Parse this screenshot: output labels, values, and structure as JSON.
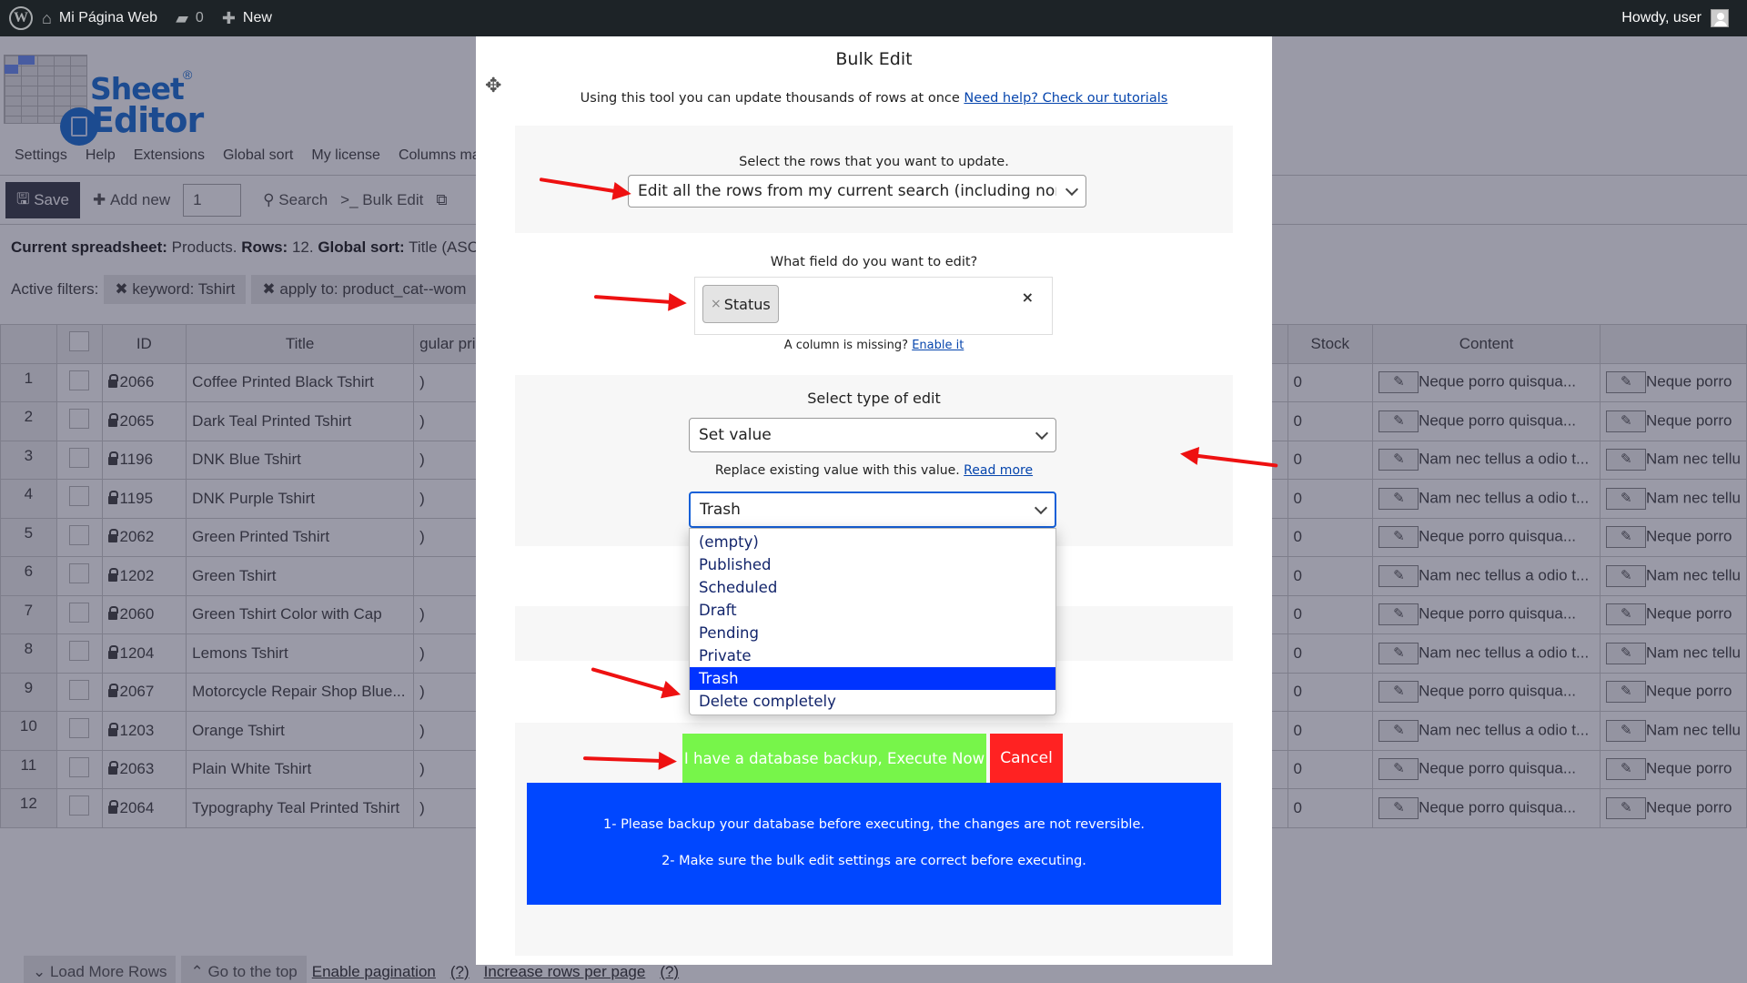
{
  "adminbar": {
    "site_name": "Mi Página Web",
    "comments_count": "0",
    "new_label": "New",
    "greeting": "Howdy, user"
  },
  "logo": {
    "line1": "Sheet",
    "line2": "Editor",
    "reg": "®"
  },
  "menu": [
    "Settings",
    "Help",
    "Extensions",
    "Global sort",
    "My license",
    "Columns ma"
  ],
  "toolbar": {
    "save": "Save",
    "add_new": "Add new",
    "add_qty": "1",
    "search": "Search",
    "bulk_edit": "Bulk Edit"
  },
  "meta": {
    "spreadsheet_label": "Current spreadsheet:",
    "spreadsheet_value": "Products.",
    "rows_label": "Rows:",
    "rows_value": "12.",
    "sort_label": "Global sort:",
    "sort_value": "Title (ASC)."
  },
  "filters": {
    "label": "Active filters:",
    "chips": [
      "keyword: Tshirt",
      "apply to: product_cat--wom"
    ]
  },
  "table": {
    "headers": {
      "id": "ID",
      "title": "Title",
      "price": "gular pri",
      "stock": "Stock",
      "content": "Content"
    },
    "rows": [
      {
        "n": "1",
        "id": "2066",
        "title": "Coffee Printed Black Tshirt",
        "price": ")",
        "stock": "0",
        "content": "Neque porro quisqua...",
        "extra": "Neque porro"
      },
      {
        "n": "2",
        "id": "2065",
        "title": "Dark Teal Printed Tshirt",
        "price": ")",
        "stock": "0",
        "content": "Neque porro quisqua...",
        "extra": "Neque porro"
      },
      {
        "n": "3",
        "id": "1196",
        "title": "DNK Blue Tshirt",
        "price": ")",
        "stock": "0",
        "content": "Nam nec tellus a odio t...",
        "extra": "Nam nec tellu"
      },
      {
        "n": "4",
        "id": "1195",
        "title": "DNK Purple Tshirt",
        "price": ")",
        "stock": "0",
        "content": "Nam nec tellus a odio t...",
        "extra": "Nam nec tellu"
      },
      {
        "n": "5",
        "id": "2062",
        "title": "Green Printed Tshirt",
        "price": ")",
        "stock": "0",
        "content": "Neque porro quisqua...",
        "extra": "Neque porro"
      },
      {
        "n": "6",
        "id": "1202",
        "title": "Green Tshirt",
        "price": "",
        "stock": "0",
        "content": "Nam nec tellus a odio t...",
        "extra": "Nam nec tellu"
      },
      {
        "n": "7",
        "id": "2060",
        "title": "Green Tshirt Color with Cap",
        "price": ")",
        "stock": "0",
        "content": "Neque porro quisqua...",
        "extra": "Neque porro"
      },
      {
        "n": "8",
        "id": "1204",
        "title": "Lemons Tshirt",
        "price": ")",
        "stock": "0",
        "content": "Nam nec tellus a odio t...",
        "extra": "Nam nec tellu"
      },
      {
        "n": "9",
        "id": "2067",
        "title": "Motorcycle Repair Shop Blue...",
        "price": ")",
        "stock": "0",
        "content": "Neque porro quisqua...",
        "extra": "Neque porro"
      },
      {
        "n": "10",
        "id": "1203",
        "title": "Orange Tshirt",
        "price": ")",
        "stock": "0",
        "content": "Nam nec tellus a odio t...",
        "extra": "Nam nec tellu"
      },
      {
        "n": "11",
        "id": "2063",
        "title": "Plain White Tshirt",
        "price": ")",
        "stock": "0",
        "content": "Neque porro quisqua...",
        "extra": "Neque porro"
      },
      {
        "n": "12",
        "id": "2064",
        "title": "Typography Teal Printed Tshirt",
        "price": ")",
        "stock": "0",
        "content": "Neque porro quisqua...",
        "extra": "Neque porro"
      }
    ]
  },
  "footer": {
    "load_more": "Load More Rows",
    "go_top": "Go to the top",
    "enable_pagination": "Enable pagination",
    "help1": "(?)",
    "increase_rows": "Increase rows per page",
    "help2": "(?)"
  },
  "modal": {
    "title": "Bulk Edit",
    "intro": "Using this tool you can update thousands of rows at once",
    "intro_link": "Need help? Check our tutorials",
    "rows_label": "Select the rows that you want to update.",
    "rows_value": "Edit all the rows from my current search (including non-visible rows)",
    "field_label": "What field do you want to edit?",
    "field_tag": "Status",
    "field_clear": "×",
    "missing_text": "A column is missing?",
    "missing_link": "Enable it",
    "type_label": "Select type of edit",
    "type_value": "Set value",
    "replace_text": "Replace existing value with this value.",
    "replace_link": "Read more",
    "value_selected": "Trash",
    "value_options": [
      "(empty)",
      "Published",
      "Scheduled",
      "Draft",
      "Pending",
      "Private",
      "Trash",
      "Delete completely"
    ],
    "execute_label": "I have a database backup, Execute Now",
    "cancel_label": "Cancel",
    "warning_1": "1- Please backup your database before executing, the changes are not reversible.",
    "warning_2": "2- Make sure the bulk edit settings are correct before executing."
  },
  "colors": {
    "execute": "#77f54a",
    "cancel": "#ff2222",
    "warning": "#0047ff",
    "option_selected": "#0033ff",
    "annotation_arrow": "#ee1111"
  }
}
